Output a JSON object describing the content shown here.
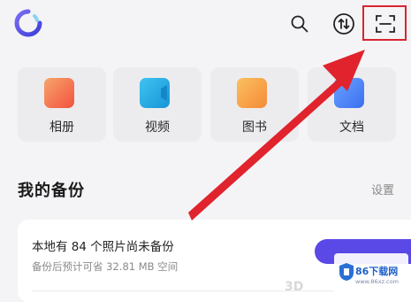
{
  "categories": [
    {
      "label": "相册",
      "icon": "album-icon",
      "color": "#f56b4c"
    },
    {
      "label": "视频",
      "icon": "video-icon",
      "color": "#21a8e8"
    },
    {
      "label": "图书",
      "icon": "book-icon",
      "color": "#f7a54a"
    },
    {
      "label": "文档",
      "icon": "document-icon",
      "color": "#4c86f5"
    }
  ],
  "backup": {
    "title": "我的备份",
    "settings_label": "设置",
    "status": "本地有 84 个照片尚未备份",
    "estimate": "备份后预计可省 32.81 MB 空间"
  },
  "watermark": {
    "brand": "86下载网",
    "url": "www.86xz.com",
    "mark": "3D"
  },
  "colors": {
    "accent": "#5a49e6",
    "highlight": "#d8262f"
  }
}
